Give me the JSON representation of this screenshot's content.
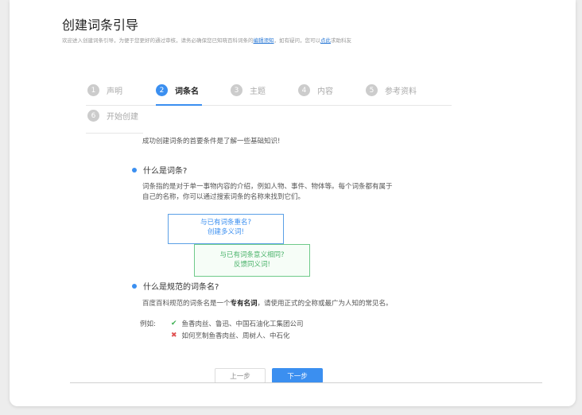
{
  "header": {
    "title": "创建词条引导",
    "subtitle_pre": "欢迎进入创建词条引导，为便于您更好的通过审核，请务必确保您已知晓百科词条的",
    "subtitle_link1": "编辑须知",
    "subtitle_mid": "，如有疑问，您可以",
    "subtitle_link2": "点此",
    "subtitle_post": "求助科友"
  },
  "steps": [
    {
      "num": "1",
      "label": "声明",
      "active": false
    },
    {
      "num": "2",
      "label": "词条名",
      "active": true
    },
    {
      "num": "3",
      "label": "主题",
      "active": false
    },
    {
      "num": "4",
      "label": "内容",
      "active": false
    },
    {
      "num": "5",
      "label": "参考资料",
      "active": false
    },
    {
      "num": "6",
      "label": "开始创建",
      "active": false
    }
  ],
  "content": {
    "intro": "成功创建词条的首要条件是了解一些基础知识!",
    "section1_title": "什么是词条?",
    "section1_line1": "词条指的是对于单一事物内容的介绍，例如人物、事件、物体等。每个词条都有属于",
    "section1_line2": "自己的名称，你可以通过搜索词条的名称来找到它们。",
    "box_blue_line1": "与已有词条重名?",
    "box_blue_line2": "创建多义词!",
    "box_green_line1": "与已有词条意义相同?",
    "box_green_line2": "反馈同义词!",
    "section2_title": "什么是规范的词条名?",
    "section2_pre": "百度百科规范的词条名是一个",
    "section2_bold": "专有名词",
    "section2_post": "，请使用正式的全称或最广为人知的常见名。",
    "examples_label": "例如:",
    "example_good": "鱼香肉丝、鲁迅、中国石油化工集团公司",
    "example_bad": "如何烹制鱼香肉丝、周树人、中石化"
  },
  "buttons": {
    "prev": "上一步",
    "next": "下一步"
  },
  "icons": {
    "check": "check-icon",
    "cross": "cross-icon"
  },
  "colors": {
    "accent": "#3b8ff0",
    "success": "#3db052",
    "error": "#e05050"
  }
}
